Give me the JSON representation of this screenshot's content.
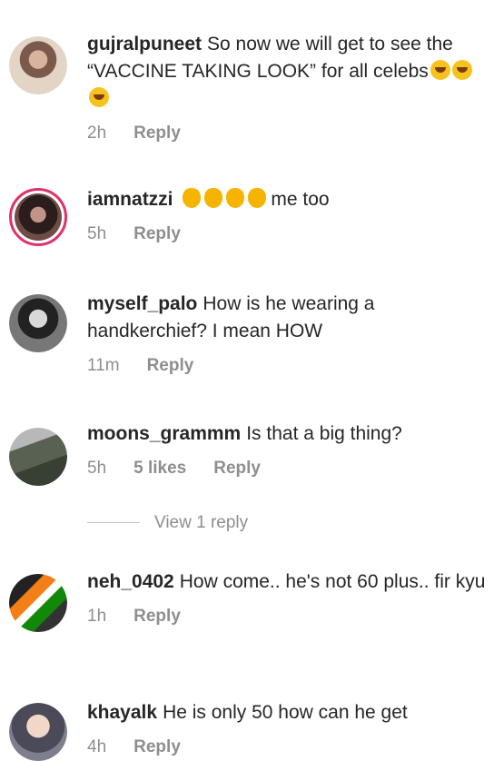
{
  "comments": [
    {
      "user": "gujralpuneet",
      "text": "So now we will get to see the “VACCINE TAKING LOOK” for all celebs",
      "time": "2h",
      "reply": "Reply"
    },
    {
      "user": "iamnatzzi",
      "text": "me too",
      "time": "5h",
      "reply": "Reply"
    },
    {
      "user": "myself_palo",
      "text": "How is he wearing a handkerchief? I mean HOW",
      "time": "11m",
      "reply": "Reply"
    },
    {
      "user": "moons_grammm",
      "text": "Is that a big thing?",
      "time": "5h",
      "likes": "5 likes",
      "reply": "Reply"
    },
    {
      "user": "neh_0402",
      "text": "How come.. he's not 60 plus.. fir kyu",
      "time": "1h",
      "reply": "Reply"
    },
    {
      "user": "khayalk",
      "text": "He is only 50 how can he get",
      "time": "4h",
      "reply": "Reply"
    }
  ],
  "view_replies": "View 1 reply",
  "colors": {
    "text": "#262626",
    "meta": "#8e8e8e",
    "story_ring": "#e1306c"
  }
}
